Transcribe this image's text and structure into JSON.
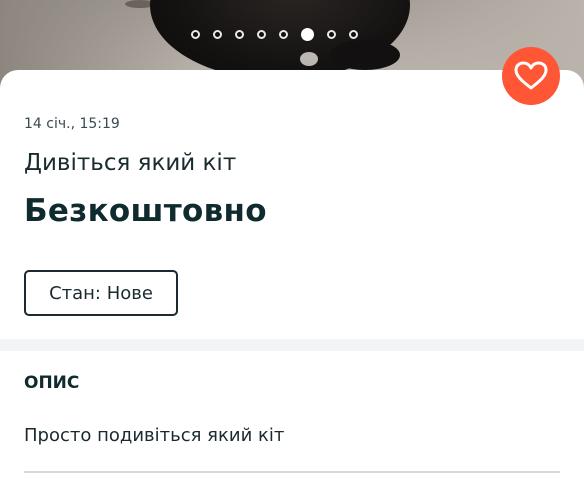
{
  "gallery": {
    "dot_count": 8,
    "active_index": 5
  },
  "listing": {
    "timestamp": "14 січ., 15:19",
    "title": "Дивіться який кіт",
    "price": "Безкоштовно",
    "condition": "Стан: Нове",
    "favorite_icon": "heart-icon"
  },
  "description": {
    "heading": "ОПИС",
    "text": "Просто подивіться який кіт"
  },
  "colors": {
    "accent": "#ff5636",
    "text_dark": "#0f2b2e",
    "separator": "#f2f4f5"
  }
}
